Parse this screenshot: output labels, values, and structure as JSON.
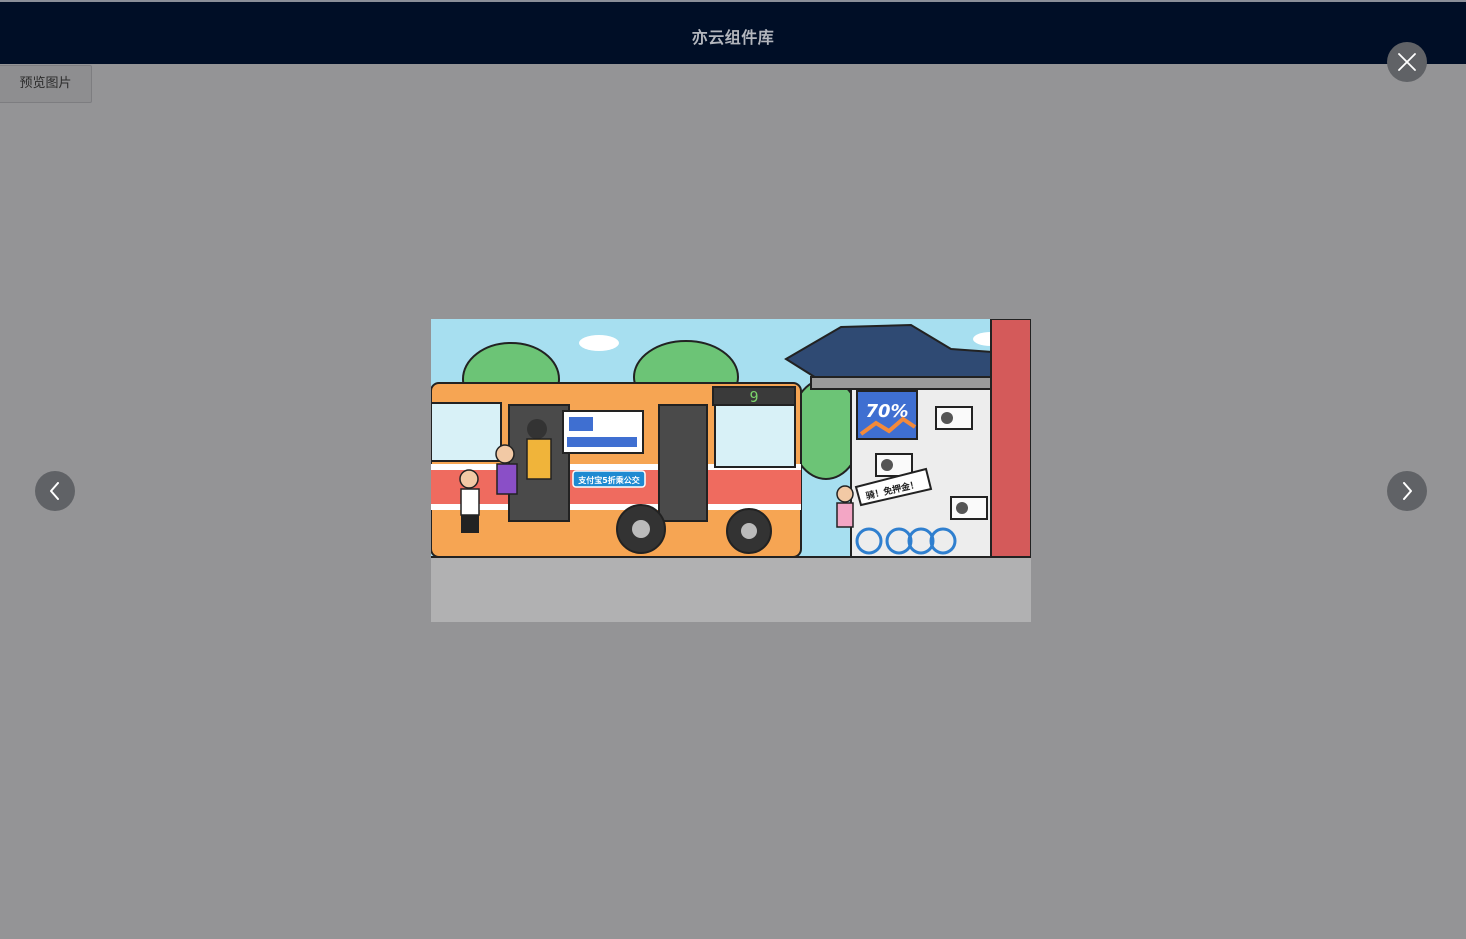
{
  "header": {
    "title": "亦云组件库"
  },
  "toolbar": {
    "preview_label": "预览图片"
  },
  "viewer": {
    "close_icon": "close-icon",
    "prev_icon": "chevron-left-icon",
    "next_icon": "chevron-right-icon",
    "image": {
      "bus_route_number": "9",
      "bus_side_banner": "支付宝5折乘公交",
      "ad_discount": "70%",
      "bike_sign": "骑！免押金！"
    }
  },
  "colors": {
    "header_bg": "#000e26",
    "overlay_bg": "#949496",
    "control_bg": "#606266"
  }
}
